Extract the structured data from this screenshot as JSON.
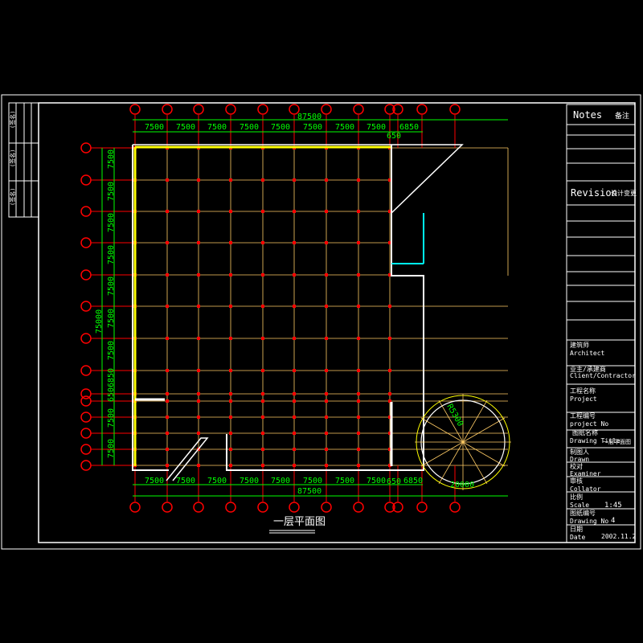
{
  "drawing_title": "一层平面图",
  "colors": {
    "background": "#000000",
    "frame": "#ffffff",
    "grid": "#ff0000",
    "dimension": "#00ff00",
    "wall": "#ffff00",
    "axis": "#ffcc66",
    "glass": "#00ffff"
  },
  "dimensions": {
    "top_total": "87500",
    "top_spans": [
      "7500",
      "7500",
      "7500",
      "7500",
      "7500",
      "7500",
      "7500",
      "7500",
      "6850"
    ],
    "top_small": "650",
    "bottom_total": "87500",
    "bottom_spans": [
      "7500",
      "7500",
      "7500",
      "7500",
      "7500",
      "7500",
      "7500",
      "7500",
      "6850"
    ],
    "bottom_small": "650",
    "left_total": "75000",
    "left_spans": [
      "7500",
      "7500",
      "7500",
      "7500",
      "7500",
      "7500",
      "7500",
      "6850",
      "7500",
      "7500"
    ],
    "left_small": "650",
    "circle_diameter": "20000",
    "circle_radius": "R5300"
  },
  "title_block": {
    "notes": "Notes",
    "notes_cn": "备注",
    "revision": "Revision",
    "revision_cn": "设计变更",
    "architect_cn": "建筑师",
    "architect": "Architect",
    "client_cn": "业主/承建商",
    "client": "Client/Contractor",
    "project_cn": "工程名称",
    "project": "Project",
    "project_no_cn": "工程编号",
    "project_no": "project No",
    "drawing_title_cn": "图纸名称",
    "drawing_title": "Drawing Title",
    "drawing_title_value": "一层平面图",
    "drawn_cn": "制图人",
    "drawn": "Drawn",
    "examiner_cn": "校对",
    "examiner": "Examiner",
    "collator_cn": "审核",
    "collator": "Collator",
    "scale_cn": "比例",
    "scale": "Scale",
    "scale_value": "1:45",
    "drawing_no_cn": "图纸编号",
    "drawing_no": "Drawing No",
    "drawing_no_value": "4",
    "date_cn": "日期",
    "date": "Date",
    "date_value": "2002.11.2"
  },
  "side_strip": [
    "(签名)",
    "(签名)",
    "(签名)"
  ]
}
